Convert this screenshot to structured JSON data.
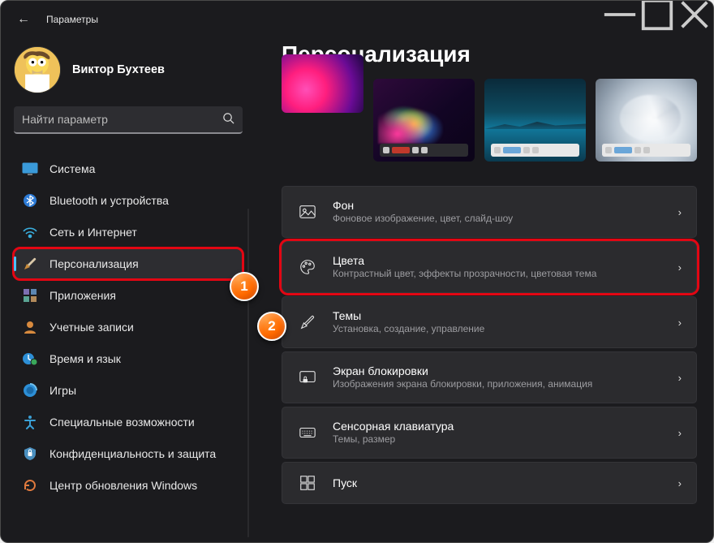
{
  "window": {
    "title": "Параметры"
  },
  "user": {
    "name": "Виктор Бухтеев",
    "email": ""
  },
  "search": {
    "placeholder": "Найти параметр"
  },
  "sidebar": {
    "items": [
      {
        "label": "Система"
      },
      {
        "label": "Bluetooth и устройства"
      },
      {
        "label": "Сеть и Интернет"
      },
      {
        "label": "Персонализация"
      },
      {
        "label": "Приложения"
      },
      {
        "label": "Учетные записи"
      },
      {
        "label": "Время и язык"
      },
      {
        "label": "Игры"
      },
      {
        "label": "Специальные возможности"
      },
      {
        "label": "Конфиденциальность и защита"
      },
      {
        "label": "Центр обновления Windows"
      }
    ]
  },
  "page": {
    "title": "Персонализация"
  },
  "cards": [
    {
      "title": "Фон",
      "sub": "Фоновое изображение, цвет, слайд-шоу"
    },
    {
      "title": "Цвета",
      "sub": "Контрастный цвет, эффекты прозрачности, цветовая тема"
    },
    {
      "title": "Темы",
      "sub": "Установка, создание, управление"
    },
    {
      "title": "Экран блокировки",
      "sub": "Изображения экрана блокировки, приложения, анимация"
    },
    {
      "title": "Сенсорная клавиатура",
      "sub": "Темы, размер"
    },
    {
      "title": "Пуск",
      "sub": ""
    }
  ],
  "annotations": {
    "b1": "1",
    "b2": "2"
  }
}
